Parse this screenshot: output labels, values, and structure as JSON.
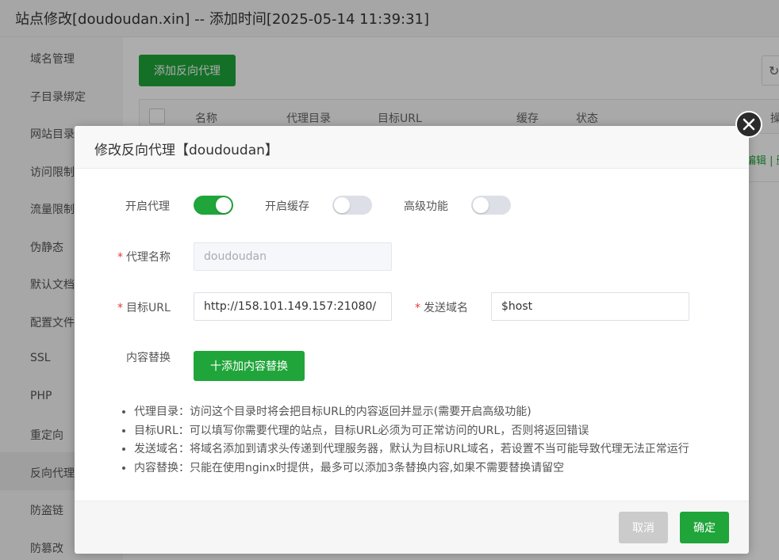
{
  "window": {
    "title": "站点修改[doudoudan.xin] -- 添加时间[2025-05-14 11:39:31]"
  },
  "sidebar": {
    "items": [
      {
        "label": "域名管理"
      },
      {
        "label": "子目录绑定"
      },
      {
        "label": "网站目录"
      },
      {
        "label": "访问限制"
      },
      {
        "label": "流量限制"
      },
      {
        "label": "伪静态"
      },
      {
        "label": "默认文档"
      },
      {
        "label": "配置文件"
      },
      {
        "label": "SSL"
      },
      {
        "label": "PHP"
      },
      {
        "label": "重定向"
      },
      {
        "label": "反向代理"
      },
      {
        "label": "防盗链"
      },
      {
        "label": "防篡改"
      }
    ],
    "active": "反向代理"
  },
  "main": {
    "add_button": "添加反向代理",
    "refresh_icon": "refresh-icon",
    "table": {
      "columns": [
        "名称",
        "代理目录",
        "目标URL",
        "缓存",
        "状态",
        "操"
      ],
      "row_actions": "编辑 | 删"
    }
  },
  "modal": {
    "title": "修改反向代理【doudoudan】",
    "close_icon": "close-icon",
    "toggles": [
      {
        "label": "开启代理",
        "state": "on"
      },
      {
        "label": "开启缓存",
        "state": "off"
      },
      {
        "label": "高级功能",
        "state": "off"
      }
    ],
    "fields": {
      "proxy_name": {
        "label": "代理名称",
        "value": "doudoudan",
        "required": "*"
      },
      "target_url": {
        "label": "目标URL",
        "value": "http://158.101.149.157:21080/",
        "required": "*"
      },
      "send_domain": {
        "label": "发送域名",
        "value": "$host",
        "required": "*"
      }
    },
    "content_replace": {
      "label": "内容替换",
      "button": "十添加内容替换"
    },
    "help": [
      "代理目录：访问这个目录时将会把目标URL的内容返回并显示(需要开启高级功能)",
      "目标URL：可以填写你需要代理的站点，目标URL必须为可正常访问的URL，否则将返回错误",
      "发送域名：将域名添加到请求头传递到代理服务器，默认为目标URL域名，若设置不当可能导致代理无法正常运行",
      "内容替换：只能在使用nginx时提供，最多可以添加3条替换内容,如果不需要替换请留空"
    ],
    "footer": {
      "cancel": "取消",
      "confirm": "确定"
    }
  },
  "colors": {
    "primary": "#20a53a",
    "required": "#e53935",
    "toggle_off": "#dcdfe6",
    "cancel_bg": "#cbcbcb"
  }
}
